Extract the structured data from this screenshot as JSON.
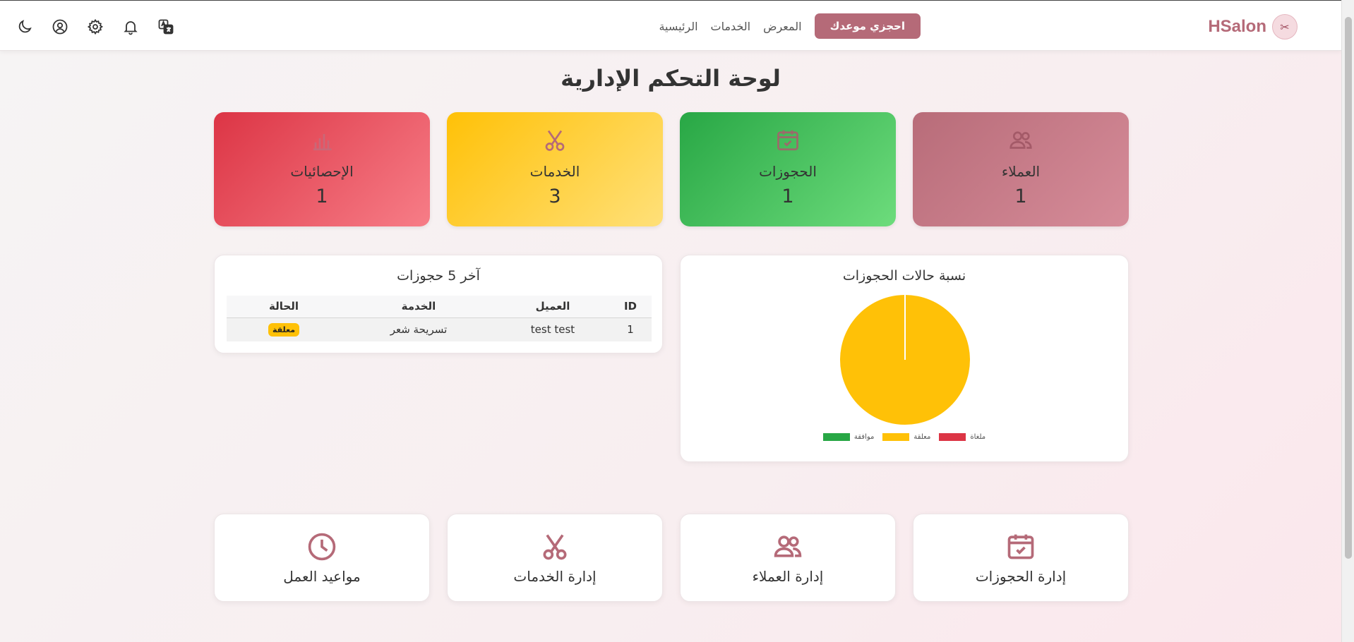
{
  "brand": {
    "name": "HSalon"
  },
  "nav": {
    "home": "الرئيسية",
    "services": "الخدمات",
    "gallery": "المعرض",
    "book_button": "احجزي موعدك"
  },
  "page_title": "لوحة التحكم الإدارية",
  "stats": [
    {
      "label": "العملاء",
      "value": "1",
      "icon": "users-icon"
    },
    {
      "label": "الحجوزات",
      "value": "1",
      "icon": "calendar-check-icon"
    },
    {
      "label": "الخدمات",
      "value": "3",
      "icon": "scissors-icon"
    },
    {
      "label": "الإحصائيات",
      "value": "1",
      "icon": "bar-chart-icon"
    }
  ],
  "latest_bookings": {
    "title": "آخر 5 حجوزات",
    "columns": [
      "ID",
      "العميل",
      "الخدمة",
      "الحالة"
    ],
    "rows": [
      {
        "id": "1",
        "client": "test test",
        "service": "تسريحة شعر",
        "status": "معلقة"
      }
    ]
  },
  "chart_data": {
    "type": "pie",
    "title": "نسبة حالات الحجوزات",
    "categories": [
      "موافقة",
      "معلقة",
      "ملغاة"
    ],
    "values": [
      0,
      1,
      0
    ],
    "colors": [
      "#28a745",
      "#ffc107",
      "#dc3545"
    ],
    "legend_position": "bottom"
  },
  "quick_links": [
    {
      "label": "إدارة الحجوزات",
      "icon": "calendar-check-icon"
    },
    {
      "label": "إدارة العملاء",
      "icon": "users-icon"
    },
    {
      "label": "إدارة الخدمات",
      "icon": "scissors-icon"
    },
    {
      "label": "مواعيد العمل",
      "icon": "clock-icon"
    }
  ],
  "colors": {
    "accent": "#b56a78",
    "pending": "#ffc107",
    "approved": "#28a745",
    "cancelled": "#dc3545"
  }
}
